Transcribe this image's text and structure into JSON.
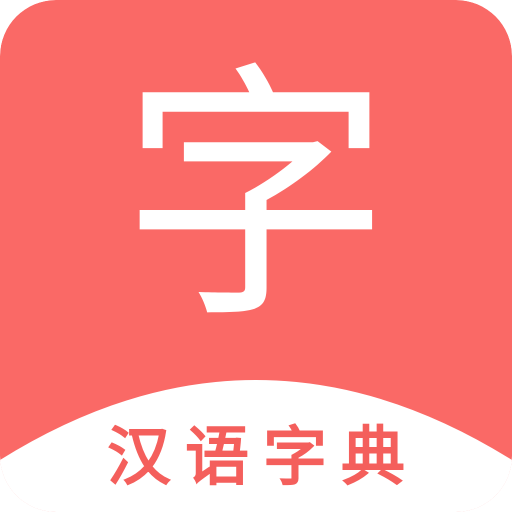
{
  "icon": {
    "glyph": "字",
    "subtitle": "汉语字典",
    "background_color": "#fa6966",
    "arc_color": "#ffffff",
    "glyph_color": "#ffffff",
    "subtitle_color": "#f45f5c"
  }
}
